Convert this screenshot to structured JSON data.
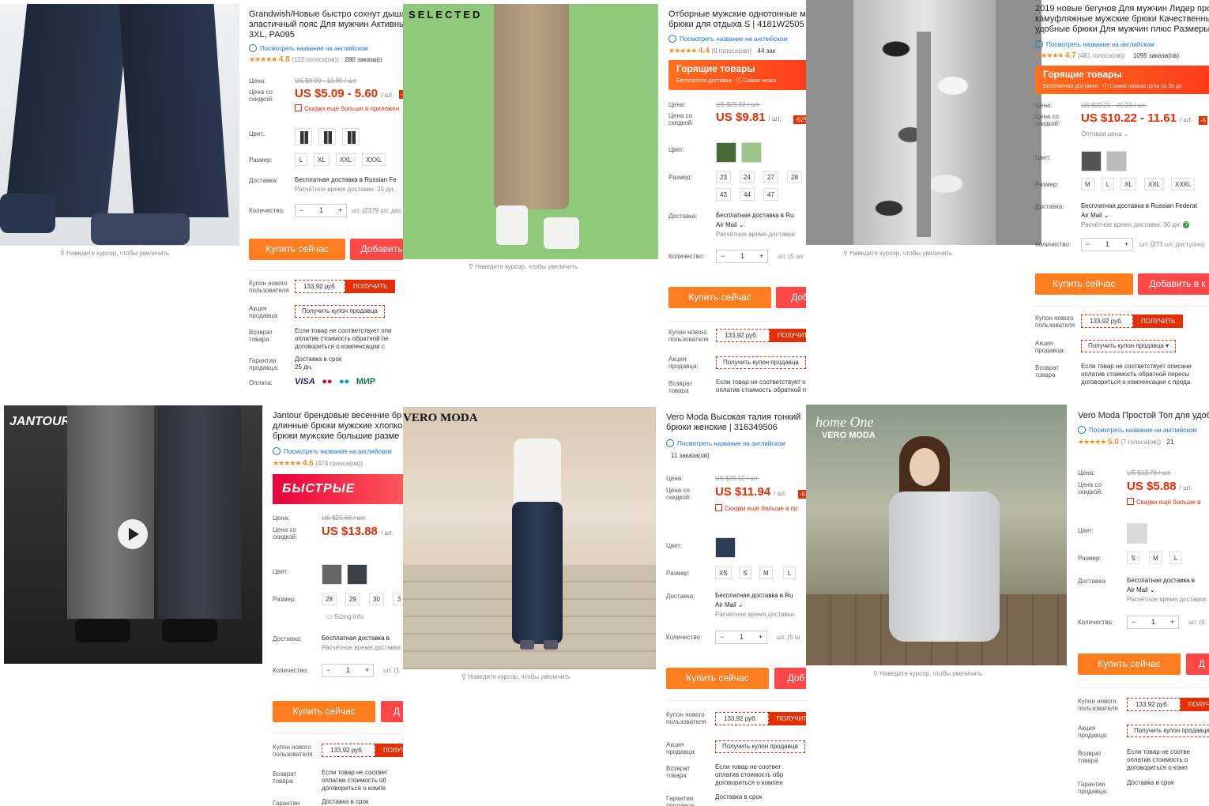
{
  "hint_zoom": "Наведите курсор, чтобы увеличить",
  "labels": {
    "price": "Цена:",
    "price_disc": "Цена со скидкой:",
    "color": "Цвет:",
    "size": "Размер:",
    "delivery": "Доставка:",
    "quantity": "Количество:",
    "coupon_new": "Купон нового пользователя",
    "seller_promo": "Акция продавца:",
    "return": "Возврат товара",
    "guarantee": "Гарантии продавца:",
    "payment": "Оплата:",
    "en_title": "Посмотреть название на английском",
    "coupon_value": "133,92 руб.",
    "get": "ПОЛУЧИТЬ",
    "get_seller_coupon": "Получить купон продавца",
    "buy_now": "Купить сейчас",
    "add_cart": "Добавить",
    "add_cart_long": "Добавить в к",
    "add_cart_short": "Доб",
    "add_cart_d": "Д",
    "free_ship_ru": "Бесплатная доставка в Russian Fe",
    "free_ship_ru2": "Бесплатная доставка в Ru",
    "free_ship_b": "Бесплатная доставка в",
    "air_mail": "Air Mail",
    "est_time": "Расчётное время доставки:",
    "return_text_1": "Если товар не соответствует опи",
    "return_text_2": "оплатив стоимость обратной пе",
    "return_text_3": "договориться о компенсации с",
    "guarantee_text": "Доставка в срок",
    "hot_title": "Горящие товары",
    "hot_sub1": "Бесплатная доставка",
    "hot_sub2": "Самая низка",
    "deals": "БЫСТРЫЕ СДЕЛКИ",
    "sub_discount": "Скидки ещё больше в приложен",
    "sub_discount_short": "Скидки ещё больше в пр",
    "sub_discount_short2": "Скидки ещё больше в",
    "wholesale": "Оптовая цена",
    "sizing_info": "Sizing info",
    "unit": "/ шт."
  },
  "products": [
    {
      "title_lines": [
        "Grandwish/Новые быстро сохнут дышащ",
        "эластичный пояс Для мужчин Активные",
        "3XL, PA095"
      ],
      "rating": "4.8",
      "votes": "(132 голоса(ов))",
      "orders": "280 заказа(о",
      "old_price": "US $9.99 - 10.99 / шт.",
      "price": "US $5.09 - 5.60",
      "sizes": [
        "L",
        "XL",
        "XXL",
        "XXXL"
      ],
      "est": "Расчётное время доставки: 25 дн.",
      "avail": "шт. (2379 шт. дос",
      "guarantee_days": "25 дн.",
      "pay": [
        "VISA",
        "●●",
        "●●",
        "МИР"
      ]
    },
    {
      "brand": "SELECTED",
      "title_lines": [
        "Отборные мужские однотонные м",
        "брюки для отдыха S | 4181W2505"
      ],
      "rating": "4.4",
      "votes": "(8 голоса(ов))",
      "orders": "44 зак",
      "old_price": "US $25.82 / шт.",
      "price": "US $9.81",
      "disc": "-62%",
      "sizes": [
        "23",
        "24",
        "27",
        "28",
        "43",
        "44",
        "47"
      ],
      "avail": "шт. (5 шт"
    },
    {
      "title_lines": [
        "2019 новые бегунов Для мужчин Лидер прод",
        "камуфляжные мужские брюки Качественны",
        "удобные брюки Для мужчин плюс Размеры М"
      ],
      "rating": "4.7",
      "votes": "(481 голоса(ов))",
      "orders": "1095 заказа(ов)",
      "old_price": "US $22.21 - 25.23 / шт.",
      "price": "US $10.22 - 11.61",
      "disc": "-5",
      "sizes": [
        "M",
        "L",
        "XL",
        "XXL",
        "XXXL"
      ],
      "ship": "Бесплатная доставка в Russian Federat",
      "est": "Расчётное время доставки: 30 дн.",
      "avail": "шт. (273 шт. доступно)",
      "hot_sub2": "Самая низкая цена за 30 дн",
      "return_lines": [
        "Если товар не соответствует описани",
        "оплатив стоимость обратной пересы",
        "договориться о компенсации с прода"
      ]
    },
    {
      "brand": "JANTOUR",
      "title_lines": [
        "Jantour брендовые весенние бр",
        "длинные брюки мужские хлопко",
        "брюки мужские большие разме"
      ],
      "rating": "4.6",
      "votes": "(474 голоса(ов))",
      "old_price": "US $25.60 / шт.",
      "price": "US $13.88",
      "sizes": [
        "28",
        "29",
        "30",
        "3"
      ],
      "avail": "шт. (1",
      "return_lines": [
        "Если товар не соответ",
        "оплатив стоимость об",
        "договориться о компе"
      ]
    },
    {
      "brand": "VERO MODA",
      "title_lines": [
        "Vero Moda Высокая талия тонкий",
        "брюки женские | 316349506"
      ],
      "orders": "11 заказа(ов)",
      "old_price": "US $29.12 / шт.",
      "price": "US $11.94",
      "disc": "-5",
      "sizes": [
        "XS",
        "S",
        "M",
        "L"
      ],
      "avail": "шт. (5 ш",
      "return_lines": [
        "Если товар не соответ",
        "оплатив стоимость обр",
        "договориться о компен"
      ]
    },
    {
      "brand_lines": [
        "home One",
        "VERO MODA"
      ],
      "title_lines": [
        "Vero Moda Простой Топ для удоб"
      ],
      "rating": "5.0",
      "votes": "(7 голоса(ов))",
      "orders": "21",
      "old_price": "US $12.79 / шт.",
      "price": "US $5.88",
      "sizes": [
        "S",
        "M",
        "L"
      ],
      "avail": "шт. (5",
      "return_lines": [
        "Если товар не соотве",
        "оплатив стоимость о",
        "договориться о комп"
      ]
    }
  ],
  "colors": {
    "accent": "#e62e04",
    "orange": "#ff7c1f",
    "link": "#1b6fd1"
  }
}
